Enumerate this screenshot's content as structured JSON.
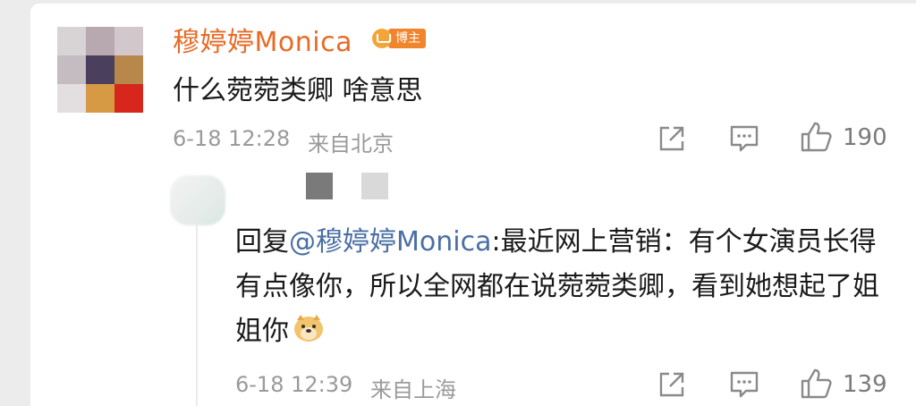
{
  "comment": {
    "author_name": "穆婷婷Monica",
    "badge_label": "博主",
    "text": "什么菀菀类卿 啥意思",
    "date": "6-18 12:28",
    "location": "来自北京",
    "likes": "190"
  },
  "reply": {
    "prefix": "回复",
    "mention": "@穆婷婷Monica",
    "body": ":最近网上营销：有个女演员长得有点像你，所以全网都在说菀菀类卿，看到她想起了姐姐你",
    "emoji": "doge-emoji",
    "date": "6-18 12:39",
    "location": "来自上海",
    "likes": "139"
  },
  "colors": {
    "author": "#e86a25",
    "mention": "#4a6fa5",
    "meta": "#9a9a9a"
  },
  "icons": [
    "share-icon",
    "comment-icon",
    "like-icon"
  ]
}
